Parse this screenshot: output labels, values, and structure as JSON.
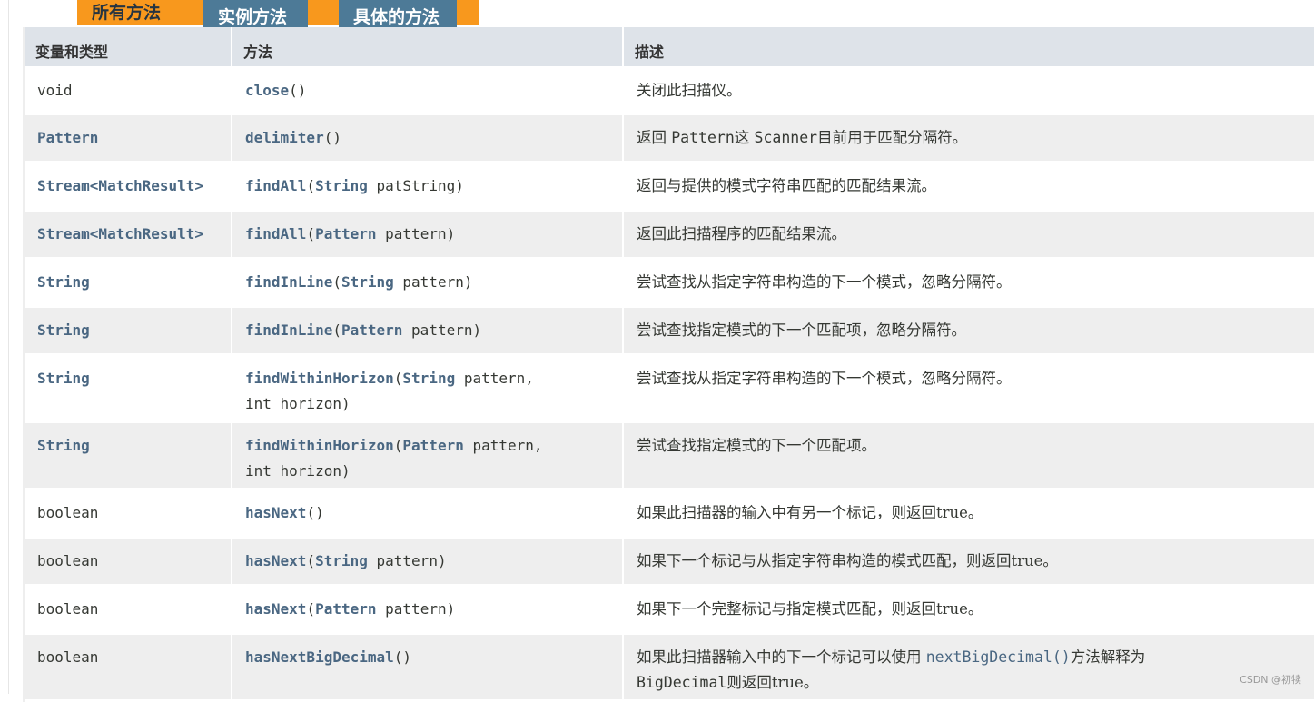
{
  "tabs": [
    {
      "label": "所有方法",
      "active": true
    },
    {
      "label": "实例方法",
      "active": false
    },
    {
      "label": "具体的方法",
      "active": false
    }
  ],
  "table": {
    "headers": [
      "变量和类型",
      "方法",
      "描述"
    ],
    "rows": [
      {
        "type": "void",
        "type_link": false,
        "method": "close",
        "params": [],
        "desc": "关闭此扫描仪。"
      },
      {
        "type": "Pattern",
        "type_link": true,
        "method": "delimiter",
        "params": [],
        "desc_parts": [
          "返回 ",
          "Pattern",
          "这 ",
          "Scanner",
          "目前用于匹配分隔符。"
        ]
      },
      {
        "type": "Stream<MatchResult>",
        "type_link": true,
        "method": "findAll",
        "params": [
          {
            "type": "String",
            "name": "patString"
          }
        ],
        "desc": "返回与提供的模式字符串匹配的匹配结果流。"
      },
      {
        "type": "Stream<MatchResult>",
        "type_link": true,
        "method": "findAll",
        "params": [
          {
            "type": "Pattern",
            "name": "pattern"
          }
        ],
        "desc": "返回此扫描程序的匹配结果流。"
      },
      {
        "type": "String",
        "type_link": true,
        "method": "findInLine",
        "params": [
          {
            "type": "String",
            "name": "pattern"
          }
        ],
        "desc": "尝试查找从指定字符串构造的下一个模式，忽略分隔符。"
      },
      {
        "type": "String",
        "type_link": true,
        "method": "findInLine",
        "params": [
          {
            "type": "Pattern",
            "name": "pattern"
          }
        ],
        "desc": "尝试查找指定模式的下一个匹配项，忽略分隔符。"
      },
      {
        "type": "String",
        "type_link": true,
        "method": "findWithinHorizon",
        "params_line1": "String",
        "params_line1_name": "pattern,",
        "params_line2": "int horizon)",
        "desc": "尝试查找从指定字符串构造的下一个模式，忽略分隔符。"
      },
      {
        "type": "String",
        "type_link": true,
        "method": "findWithinHorizon",
        "params_line1": "Pattern",
        "params_line1_name": "pattern,",
        "params_line2": "int horizon)",
        "desc": "尝试查找指定模式的下一个匹配项。"
      },
      {
        "type": "boolean",
        "type_link": false,
        "method": "hasNext",
        "params": [],
        "desc_a": "如果此扫描器的输入中有另一个标记，则返回",
        "desc_b": "true",
        "desc_c": "。"
      },
      {
        "type": "boolean",
        "type_link": false,
        "method": "hasNext",
        "params": [
          {
            "type": "String",
            "name": "pattern"
          }
        ],
        "desc_a": "如果下一个标记与从指定字符串构造的模式匹配，则返回",
        "desc_b": "true",
        "desc_c": "。"
      },
      {
        "type": "boolean",
        "type_link": false,
        "method": "hasNext",
        "params": [
          {
            "type": "Pattern",
            "name": "pattern"
          }
        ],
        "desc_a": "如果下一个完整标记与指定模式匹配，则返回",
        "desc_b": "true",
        "desc_c": "。"
      },
      {
        "type": "boolean",
        "type_link": false,
        "method": "hasNextBigDecimal",
        "params": [],
        "desc_a": "如果此扫描器输入中的下一个标记可以使用 ",
        "desc_link": "nextBigDecimal()",
        "desc_a2": "方法解释为",
        "desc_line2_code": "BigDecimal",
        "desc_line2_a": "则返回",
        "desc_b": "true",
        "desc_c": "。"
      }
    ]
  },
  "watermark": "CSDN @初犊",
  "colors": {
    "tab_active": "#f8981d",
    "tab_inactive": "#4d7a97",
    "header_bg": "#dee3e9",
    "row_alt": "#eeeeee",
    "link": "#4a6782"
  }
}
